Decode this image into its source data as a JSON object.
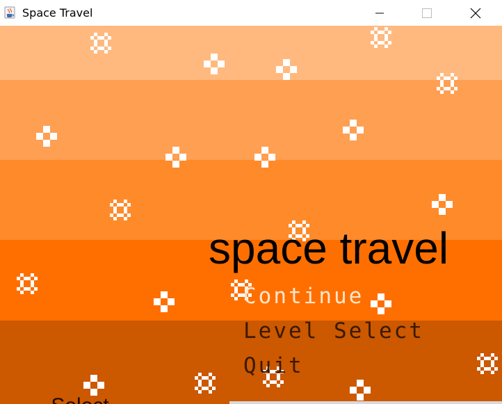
{
  "window": {
    "title": "Space Travel",
    "icon": "java-cup-icon",
    "controls": [
      "minimize",
      "maximize",
      "close"
    ]
  },
  "game": {
    "title": "space travel",
    "background_colors": [
      "#ffb97f",
      "#ff9f52",
      "#ff8a2a",
      "#ff6f00",
      "#cc5800"
    ],
    "menu": [
      {
        "label": "Continue",
        "selected": true
      },
      {
        "label": "Level Select",
        "selected": false
      },
      {
        "label": "Quit",
        "selected": false
      }
    ],
    "bottom_partial_text": "... Select"
  }
}
